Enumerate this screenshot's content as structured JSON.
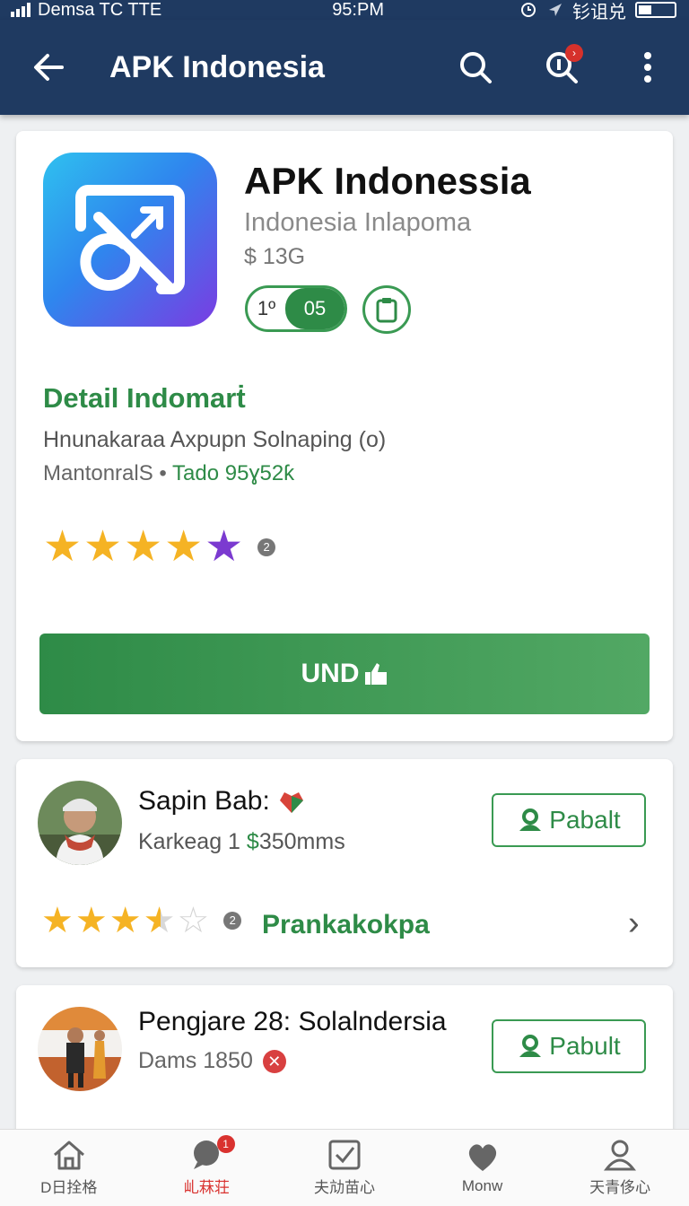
{
  "status_bar": {
    "carrier": "Demsa  TC  TTE",
    "time": "95:PM",
    "right_text": "钐诅兑"
  },
  "app_bar": {
    "title": "APK Indonesia",
    "notification_badge": "›"
  },
  "app_card": {
    "title": "APK Indonessia",
    "subtitle": "Indonesia Inlapoma",
    "price": "$ 13G",
    "toggle_left": "1º",
    "toggle_right": "05",
    "detail_heading": "Detail Indomarṫ",
    "detail_line": "Hnunakaraa Axpupn Solnaping (o)",
    "meta_left": "Mantonral",
    "meta_sep": "S • ",
    "meta_right": "Tado 95ɣ52ƙ",
    "rating_count": "2",
    "cta_label": "UND"
  },
  "developers": [
    {
      "name": "Sapin Bab:",
      "meta_plain": "Karkeag  1 ",
      "meta_accent": "$",
      "meta_tail": "350mms",
      "button": "Pabalt",
      "rating_count": "2",
      "link": "Prankakokpa"
    },
    {
      "name": "Pengjare 28: Solalndersia",
      "meta_plain": "Dams 1850",
      "button": "Pabult"
    }
  ],
  "bottom_nav": [
    {
      "label": "D日拴格",
      "icon": "home-icon"
    },
    {
      "label": "乢菻荘",
      "icon": "chat-icon",
      "badge": "1",
      "active": true
    },
    {
      "label": "夫劥苗心",
      "icon": "checkbox-icon"
    },
    {
      "label": "Monw",
      "icon": "heart-icon"
    },
    {
      "label": "天青侈心",
      "icon": "profile-icon"
    }
  ],
  "colors": {
    "appbar": "#1f3a61",
    "accent_green": "#2e8b47",
    "star": "#f5b324",
    "badge_red": "#d9322f"
  }
}
